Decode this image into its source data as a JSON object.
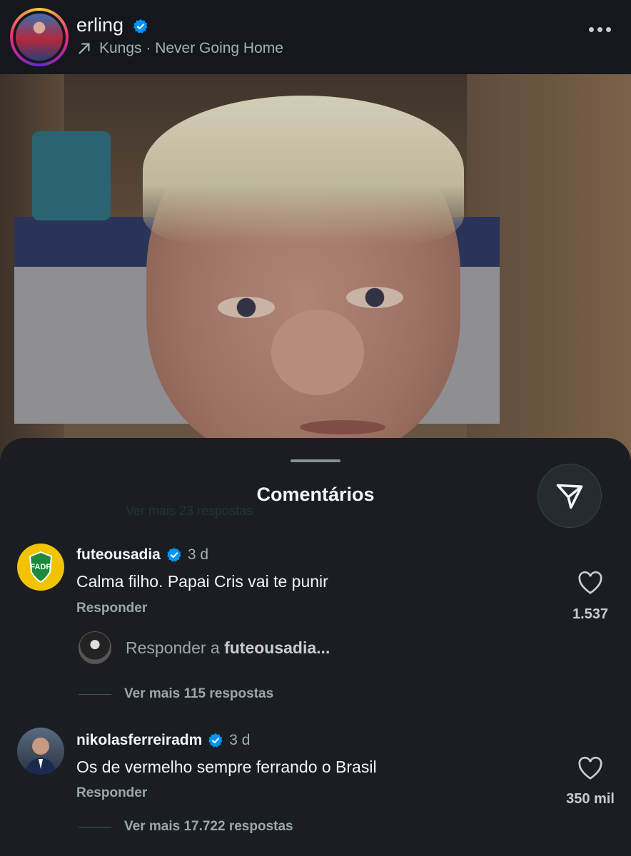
{
  "header": {
    "username": "erling",
    "music": "Kungs · Never Going Home"
  },
  "sheet": {
    "title": "Comentários",
    "ghost_text": "Ver mais 23 respostas"
  },
  "comments": [
    {
      "user": "futeousadia",
      "time": "3 d",
      "text": "Calma filho. Papai Cris vai te punir",
      "reply_label": "Responder",
      "likes": "1.537",
      "avatar_text": "FADP",
      "reply_prompt_prefix": "Responder a ",
      "reply_prompt_user": "futeousadia...",
      "more_replies": "Ver mais 115 respostas"
    },
    {
      "user": "nikolasferreiradm",
      "time": "3 d",
      "text": "Os de vermelho sempre ferrando o Brasil",
      "reply_label": "Responder",
      "likes": "350 mil",
      "more_replies": "Ver mais 17.722 respostas"
    }
  ],
  "colors": {
    "verified": "#0095f6",
    "background": "#1a1e23",
    "header": "#14181d"
  }
}
